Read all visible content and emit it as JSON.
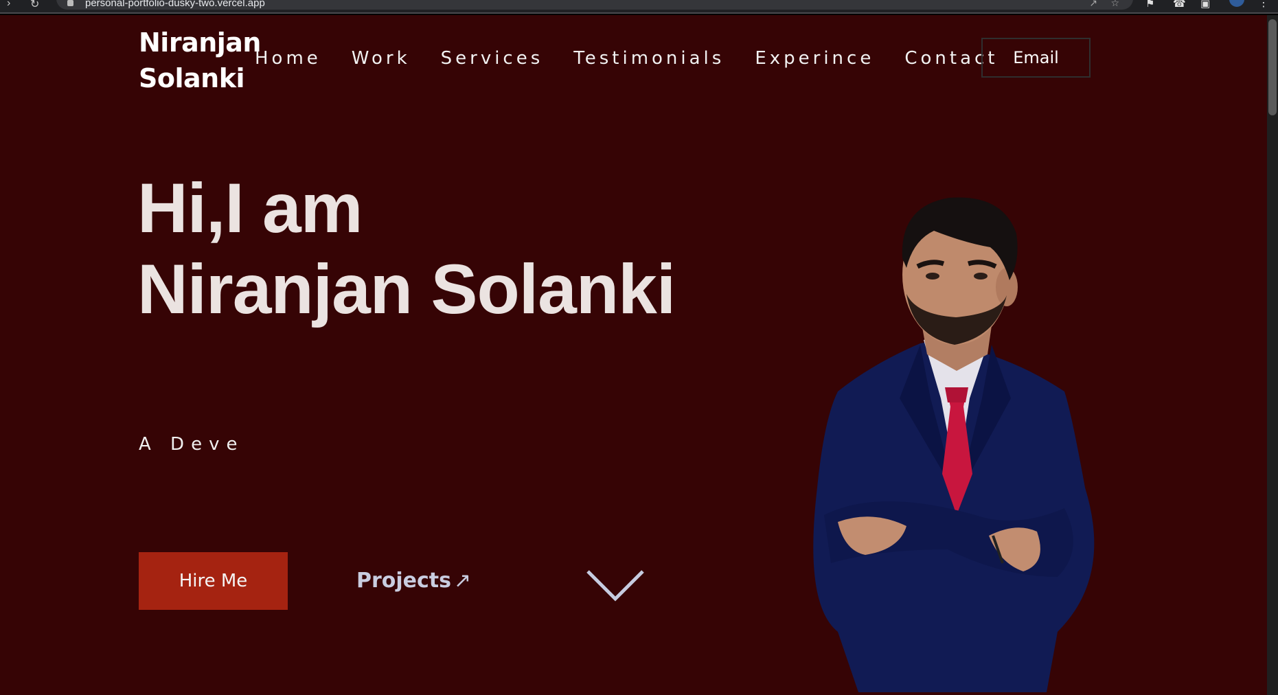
{
  "browser": {
    "url": "personal-portfolio-dusky-two.vercel.app",
    "icons": [
      "back-icon",
      "reload-icon",
      "lock-icon",
      "share-icon",
      "star-icon",
      "extension-icon",
      "whatsapp-icon",
      "window-icon",
      "profile-icon",
      "menu-icon"
    ]
  },
  "header": {
    "brand_line1": "Niranjan",
    "brand_line2": "Solanki",
    "nav": [
      "Home",
      "Work",
      "Services",
      "Testimonials",
      "Experince",
      "Contact"
    ],
    "email_label": "Email"
  },
  "hero": {
    "title_line1": "Hi,I am",
    "title_line2": "Niranjan Solanki",
    "tagline": "A Deve",
    "hire_label": "Hire Me",
    "projects_label": "Projects",
    "projects_icon": "arrow-up-right-icon",
    "scroll_icon": "chevron-down-icon"
  },
  "colors": {
    "background": "#360405",
    "accent_button": "#a52311",
    "heading_text": "#ebe3e1",
    "link_text": "#c9cde0"
  }
}
